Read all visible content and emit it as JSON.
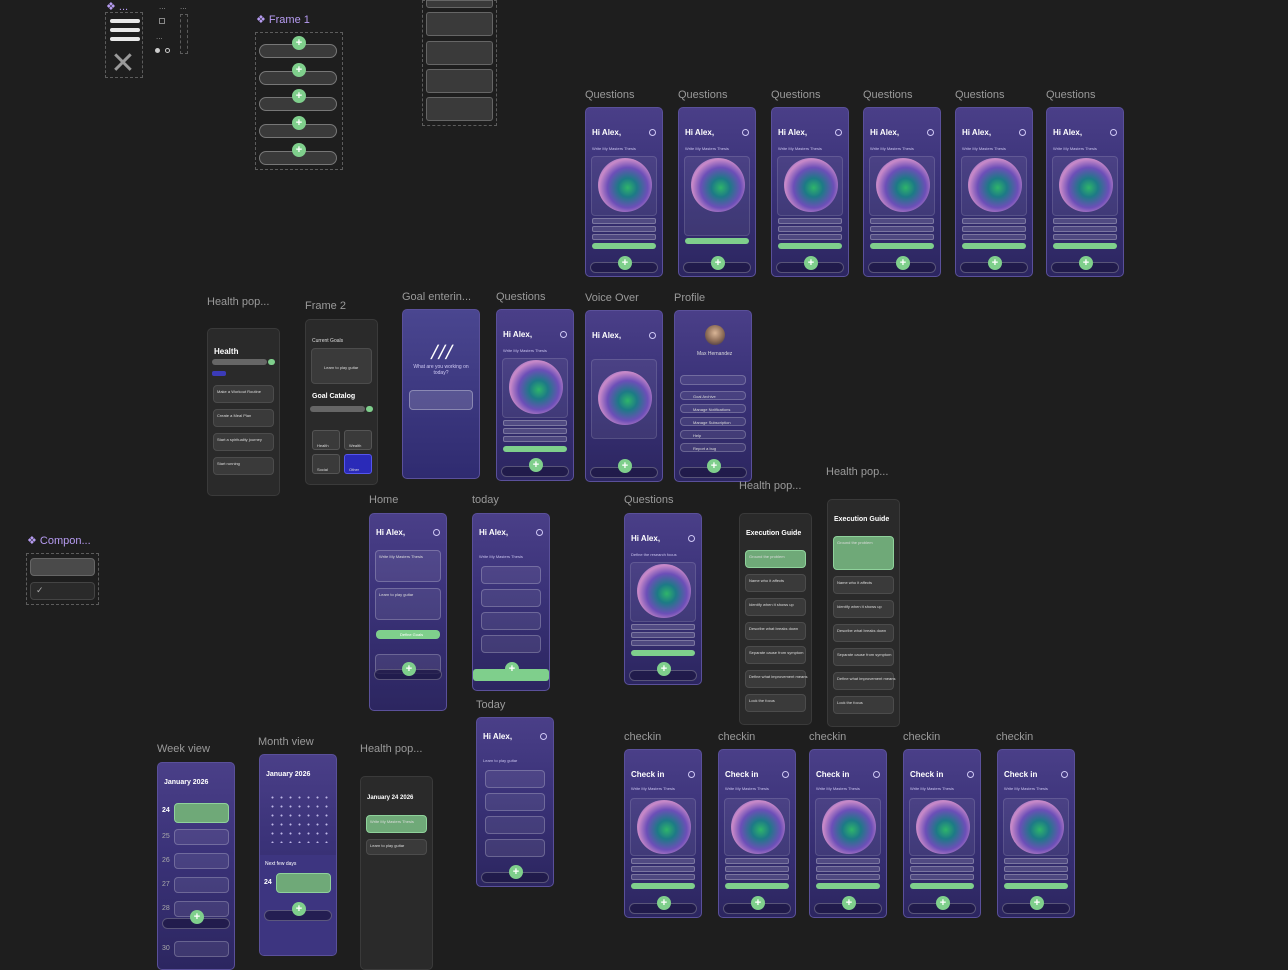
{
  "top_components": {
    "symbol_label": "...",
    "dots_a": "...",
    "dots_b": "...",
    "dots_c": "..."
  },
  "frame1": {
    "title": "Frame 1"
  },
  "component": {
    "title": "Compon..."
  },
  "labels": {
    "questions": "Questions",
    "health_pop": "Health pop...",
    "frame2": "Frame 2",
    "goal_entering": "Goal enterin...",
    "voice_over": "Voice Over",
    "profile": "Profile",
    "home": "Home",
    "today_lower": "today",
    "today_upper": "Today",
    "week_view": "Week view",
    "month_view": "Month view",
    "checkin": "checkin"
  },
  "screens": {
    "greeting": "Hi Alex,",
    "project": "Write My Masters Thesis",
    "health_title": "Health",
    "current_goals": "Current Goals",
    "learn_guitar": "Learn to play guitar",
    "goal_catalog": "Goal Catalog",
    "goal_question": "What are you working on today?",
    "profile_name": "Max Hernandez",
    "checkin_title": "Check in",
    "execution_guide": "Execution Guide",
    "define_focus": "Define the research focus",
    "january": "January 2026",
    "january_24": "January 24  2026",
    "next_few_days": "Next few days",
    "day_24": "24",
    "plus": "+"
  },
  "health_items": [
    "Make a Workout Routine",
    "Create a Meal Plan",
    "Start a spirituality journey",
    "Start running"
  ],
  "goal_categories": [
    "Health",
    "Wealth",
    "Social",
    "Other"
  ],
  "guide_steps": [
    "Ground the problem",
    "Name who it affects",
    "Identify when it shows up",
    "Describe what breaks down",
    "Separate cause from symptom",
    "Define what improvement means",
    "Lock the focus"
  ],
  "profile_items": [
    "Goal Archive",
    "Manage Notifications",
    "Manage Subscription",
    "Help",
    "Report a bug"
  ],
  "week_days": [
    "24",
    "25",
    "26",
    "27",
    "28",
    "29",
    "30"
  ],
  "home_button": "Define Goals"
}
